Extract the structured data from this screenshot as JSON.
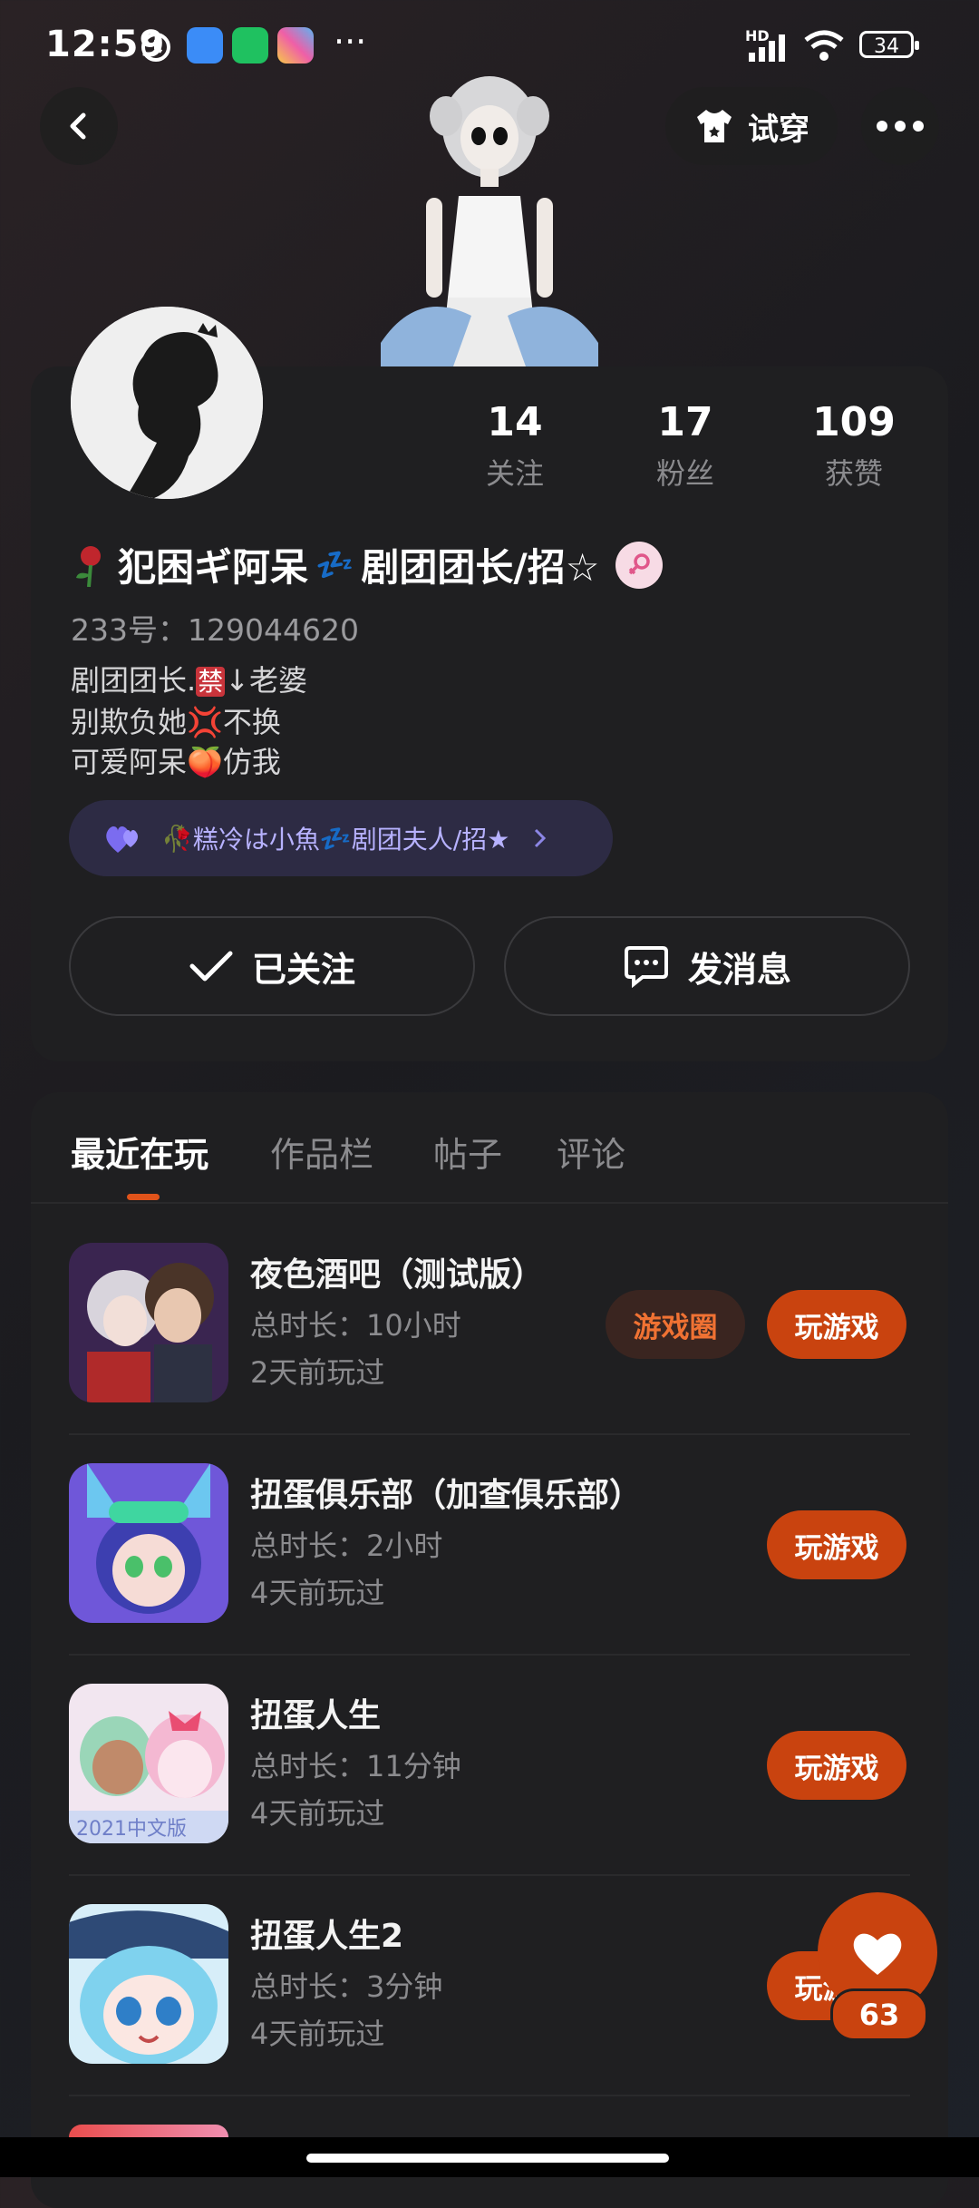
{
  "status_bar": {
    "time": "12:59",
    "battery": "34",
    "signal": "HD"
  },
  "top": {
    "try_on_label": "试穿"
  },
  "profile": {
    "stats": [
      {
        "value": "14",
        "label": "关注"
      },
      {
        "value": "17",
        "label": "粉丝"
      },
      {
        "value": "109",
        "label": "获赞"
      }
    ],
    "name": "犯困ギ阿呆",
    "name_suffix": "剧团团长/招☆",
    "uid": "233号：129044620",
    "bio": [
      "剧团团长.",
      "↓老婆",
      "别欺负她",
      "不换",
      "可爱阿呆",
      "仿我"
    ],
    "bio_badge": "禁",
    "couple_name": "糕冷は小魚",
    "couple_suffix": "剧团夫人/招★",
    "followed_label": "已关注",
    "message_label": "发消息"
  },
  "tabs": [
    "最近在玩",
    "作品栏",
    "帖子",
    "评论"
  ],
  "games": [
    {
      "title": "夜色酒吧（测试版）",
      "duration": "总时长：10小时",
      "last": "2天前玩过",
      "circle": "游戏圈",
      "play": "玩游戏"
    },
    {
      "title": "扭蛋俱乐部（加查俱乐部）",
      "duration": "总时长：2小时",
      "last": "4天前玩过",
      "play": "玩游戏"
    },
    {
      "title": "扭蛋人生",
      "duration": "总时长：11分钟",
      "last": "4天前玩过",
      "play": "玩游戏",
      "icon_text": "2021中文版"
    },
    {
      "title": "扭蛋人生2",
      "duration": "总时长：3分钟",
      "last": "4天前玩过",
      "play": "玩游戏"
    }
  ],
  "like_count": "63",
  "colors": {
    "accent": "#c9430f",
    "card": "#1f1f21",
    "couple_bg": "#2d2b44"
  }
}
